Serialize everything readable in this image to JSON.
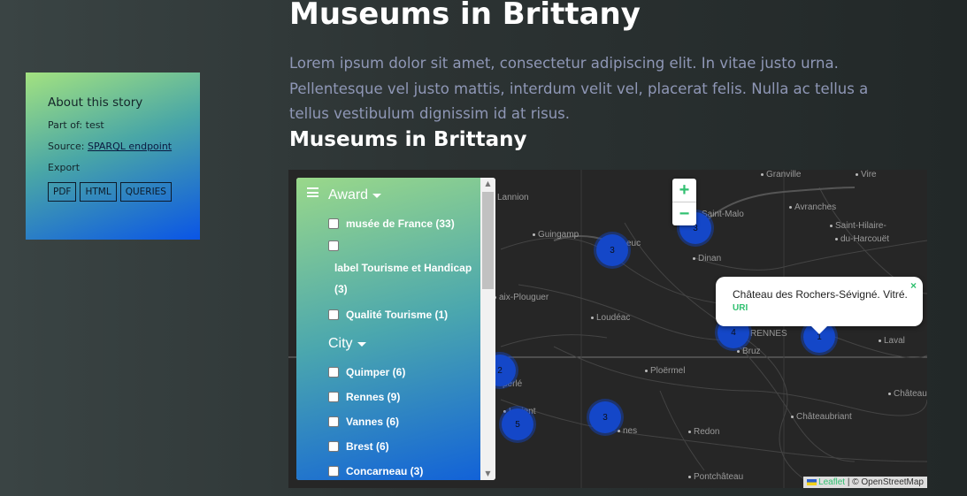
{
  "story": {
    "heading": "About this story",
    "part_of": "Part of: test",
    "source_prefix": "Source: ",
    "source_link": "SPARQL endpoint",
    "export_label": "Export",
    "export_buttons": [
      "PDF",
      "HTML",
      "QUERIES"
    ]
  },
  "page": {
    "title": "Museums in Brittany",
    "intro": "Lorem ipsum dolor sit amet, consectetur adipiscing elit. In vitae justo urna. Pellentesque vel justo mattis, interdum velit vel, placerat felis. Nulla ac tellus a tellus vestibulum dignissim id at risus.",
    "section_title": "Museums in Brittany"
  },
  "facets": {
    "award": {
      "label": "Award",
      "options": [
        "musée de France (33)",
        "",
        "Qualité Tourisme (1)"
      ],
      "wrapped_label_line1": "label Tourisme et Handicap",
      "wrapped_label_line2": "(3)"
    },
    "city": {
      "label": "City",
      "options": [
        "Quimper (6)",
        "Rennes (9)",
        "Vannes (6)",
        "Brest (6)",
        "Concarneau (3)"
      ]
    }
  },
  "map": {
    "zoom_in": "+",
    "zoom_out": "−",
    "places": [
      "Granville",
      "Vire",
      "Avranches",
      "Saint-Hilaire-",
      "du-Harcouët",
      "Saint-Malo",
      "Dinan",
      "Guingamp",
      "Lannion",
      "aix-Plouguer",
      "Loudéac",
      "RENNES",
      "Bruz",
      "Laval",
      "Ploërmel",
      "Château-",
      "Châteaubriant",
      "Redon",
      "Pontchâteau",
      "perlé",
      "Lorient",
      "nes",
      "euc"
    ],
    "clusters": [
      "3",
      "3",
      "4",
      "1",
      "2",
      "5",
      "3"
    ],
    "popup": {
      "text": "Château des Rochers-Sévigné. Vitré.",
      "link": "URI",
      "close": "×"
    },
    "attribution": {
      "leaflet": "Leaflet",
      "rest": " | © OpenStreetMap"
    }
  }
}
